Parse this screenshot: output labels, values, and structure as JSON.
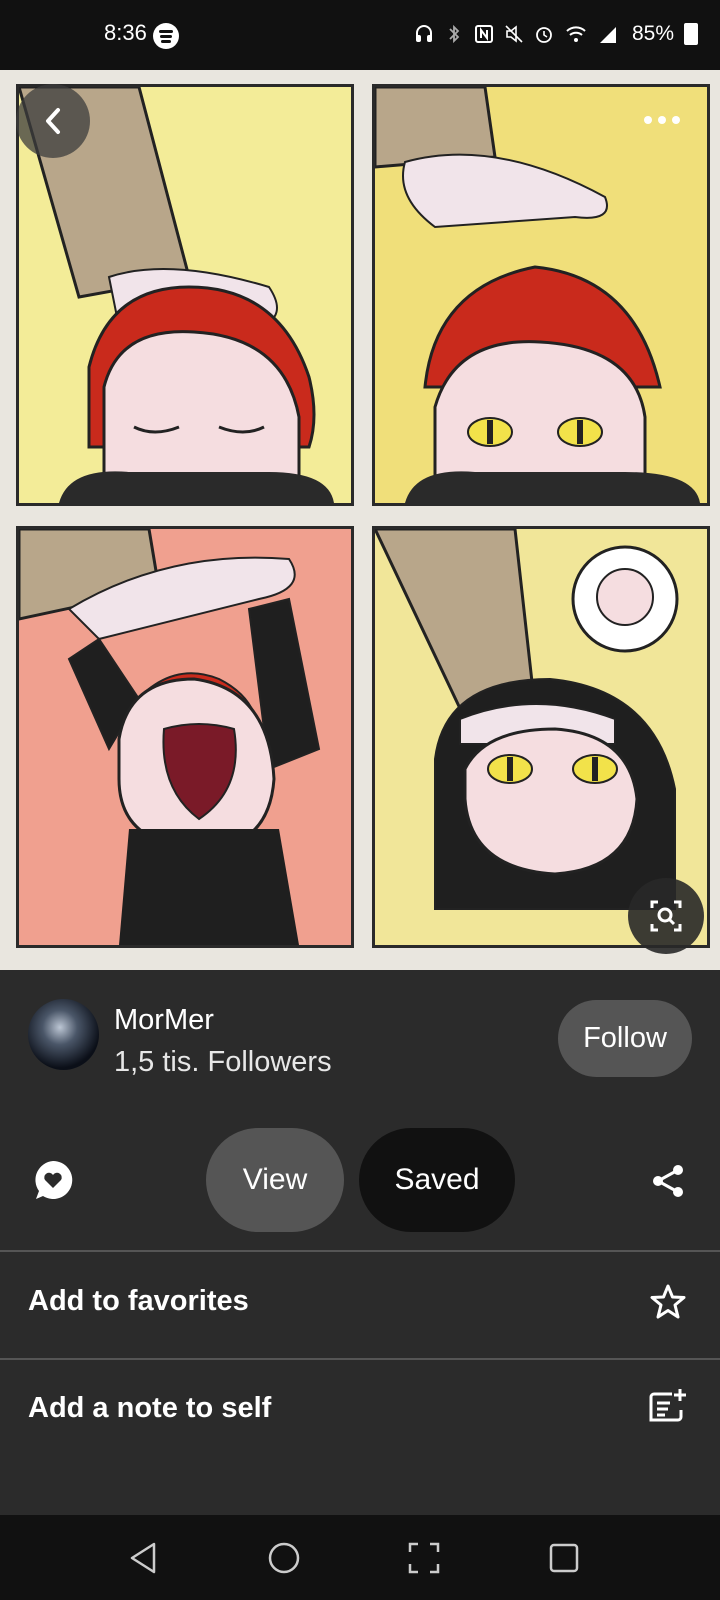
{
  "status_bar": {
    "time": "8:36",
    "battery_percent": "85%",
    "icons": [
      "spotify-icon",
      "headphones-icon",
      "bluetooth-icon",
      "nfc-icon",
      "mute-icon",
      "alarm-icon",
      "wifi-icon",
      "signal-icon",
      "battery-icon"
    ]
  },
  "image": {
    "alt": "Four-panel comic",
    "controls": [
      "back-icon",
      "more-icon",
      "lens-search-icon"
    ]
  },
  "creator": {
    "name": "MorMer",
    "followers": "1,5 tis. Followers",
    "follow_label": "Follow"
  },
  "actions": {
    "view_label": "View",
    "saved_label": "Saved"
  },
  "menu": {
    "favorites_label": "Add to favorites",
    "note_label": "Add a note to self"
  },
  "colors": {
    "background": "#2b2b2b",
    "button": "#555555",
    "saved_button": "#111111"
  }
}
